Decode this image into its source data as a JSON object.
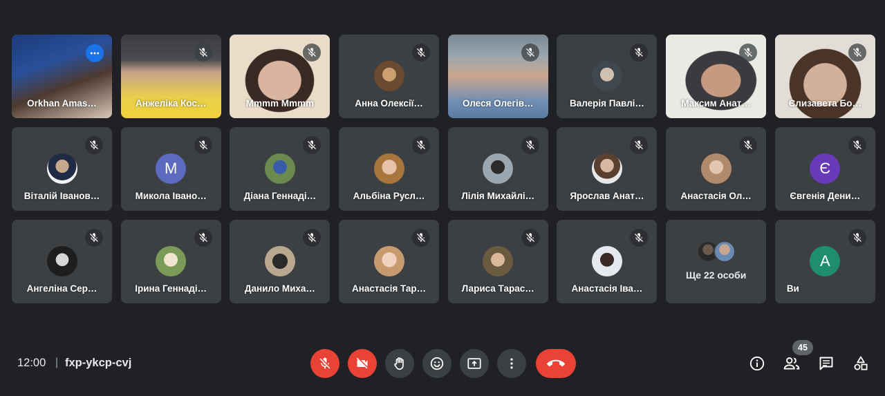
{
  "participants": [
    {
      "name": "Orkhan Amas…",
      "kind": "video",
      "active": true,
      "bg": "linear-gradient(160deg,#1b3a7a 0%,#2a4f9a 35%,#4c3a30 60%,#d8c8b8 100%)",
      "icon": "more-options-icon"
    },
    {
      "name": "Анжеліка Кос…",
      "kind": "video",
      "bg": "linear-gradient(180deg,#3a3c40 0%,#4a4c50 30%,#c9a28a 45%,#e8d04a 75%,#f2d23c 100%)",
      "icon": "mic-off-icon"
    },
    {
      "name": "Mmmm Mmmm",
      "kind": "video",
      "bg": "radial-gradient(ellipse at 50% 55%,#d9b5a0 0 30%,#3a2a24 31% 48%,#e9dcc8 49% 100%)",
      "icon": "mic-off-icon"
    },
    {
      "name": "Анна Олексії…",
      "kind": "avatar",
      "avatar": "radial-gradient(circle at 50% 45%,#caa070 0 30%,#6a4a30 31% 100%)",
      "icon": "mic-off-icon"
    },
    {
      "name": "Олеся Олегів…",
      "kind": "video",
      "bg": "linear-gradient(180deg,#7a8894 0%,#9aa6ae 25%,#c9a58e 50%,#6f8fb5 80%,#5a7aa0 100%)",
      "icon": "mic-off-icon"
    },
    {
      "name": "Валерія Павлі…",
      "kind": "avatar",
      "avatar": "radial-gradient(circle at 50% 45%,#d0c0b0 0 30%,#40474f 31% 100%)",
      "icon": "mic-off-icon"
    },
    {
      "name": "Максим Анат…",
      "kind": "video",
      "bg": "radial-gradient(ellipse at 55% 55%,#c69a80 0 25%,#3a3a3f 26% 45%,#e8ebe4 46% 100%)",
      "icon": "mic-off-icon"
    },
    {
      "name": "Єлизавета Бо…",
      "kind": "video",
      "bg": "radial-gradient(ellipse at 50% 60%,#d3b09a 0 30%,#4a3428 31% 50%,#e2ddd6 51% 100%)",
      "icon": "mic-off-icon"
    },
    {
      "name": "Віталій Іванов…",
      "kind": "avatar",
      "avatar": "radial-gradient(circle at 50% 42%,#c6a88c 0 28%,#1f2a44 29% 60%,#f4f4f4 61% 100%)",
      "icon": "mic-off-icon"
    },
    {
      "name": "Микола Івано…",
      "kind": "letter",
      "letter": "М",
      "color": "#5c6bc0",
      "icon": "mic-off-icon"
    },
    {
      "name": "Діана Геннаді…",
      "kind": "avatar",
      "avatar": "radial-gradient(circle at 50% 45%,#3a5ba8 0 30%,#6a8a50 31% 100%)",
      "icon": "mic-off-icon"
    },
    {
      "name": "Альбіна Русл…",
      "kind": "avatar",
      "avatar": "radial-gradient(circle at 50% 45%,#e6c2a8 0 32%,#a8753c 33% 100%)",
      "icon": "mic-off-icon"
    },
    {
      "name": "Лілія Михайлі…",
      "kind": "avatar",
      "avatar": "radial-gradient(circle at 50% 45%,#2a2a2a 0 30%,#9aa6b0 31% 100%)",
      "icon": "mic-off-icon"
    },
    {
      "name": "Ярослав Анат…",
      "kind": "avatar",
      "avatar": "radial-gradient(circle at 50% 40%,#d8b8a0 0 28%,#5a4030 29% 55%,#e8e8e8 56% 100%)",
      "icon": "mic-off-icon"
    },
    {
      "name": "Анастасія Ол…",
      "kind": "avatar",
      "avatar": "radial-gradient(circle at 50% 45%,#e2c6b2 0 30%,#b08a6a 31% 100%)",
      "icon": "mic-off-icon"
    },
    {
      "name": "Євгенія Дени…",
      "kind": "letter",
      "letter": "Є",
      "color": "#673ab7",
      "icon": "mic-off-icon"
    },
    {
      "name": "Ангеліна Сер…",
      "kind": "avatar",
      "avatar": "radial-gradient(circle at 50% 45%,#d6d6d6 0 28%,#1e1e1e 29% 100%)",
      "icon": "mic-off-icon"
    },
    {
      "name": "Ірина Геннаді…",
      "kind": "avatar",
      "avatar": "radial-gradient(circle at 50% 45%,#f0e6d0 0 30%,#7a9a58 31% 100%)",
      "icon": "mic-off-icon"
    },
    {
      "name": "Данило Миха…",
      "kind": "avatar",
      "avatar": "radial-gradient(circle at 50% 50%,#2a2a2a 0 35%,#b8a890 36% 100%)",
      "icon": "mic-off-icon"
    },
    {
      "name": "Анастасія Тар…",
      "kind": "avatar",
      "avatar": "radial-gradient(circle at 50% 45%,#f0d2bf 0 32%,#c89a70 33% 100%)",
      "icon": "mic-off-icon"
    },
    {
      "name": "Лариса Тарас…",
      "kind": "avatar",
      "avatar": "radial-gradient(circle at 50% 45%,#dcb89a 0 30%,#6a5a40 31% 100%)",
      "icon": "mic-off-icon"
    },
    {
      "name": "Анастасія Іва…",
      "kind": "avatar",
      "avatar": "radial-gradient(circle at 50% 45%,#3a2a26 0 30%,#e6eaf0 31% 100%)",
      "icon": "mic-off-icon"
    },
    {
      "name": "",
      "kind": "more",
      "more_label": "Ще 22 особи"
    },
    {
      "name": "Ви",
      "kind": "letter",
      "letter": "A",
      "color": "#1e8e6e",
      "icon": "mic-off-icon",
      "leftName": true
    }
  ],
  "bottom": {
    "time": "12:00",
    "separator": "|",
    "meeting_code": "fxp-ykcp-cvj",
    "participant_count": "45"
  },
  "colors": {
    "background": "#202124",
    "tile": "#3c4043",
    "danger": "#ea4335",
    "accent": "#8ab4f8"
  }
}
